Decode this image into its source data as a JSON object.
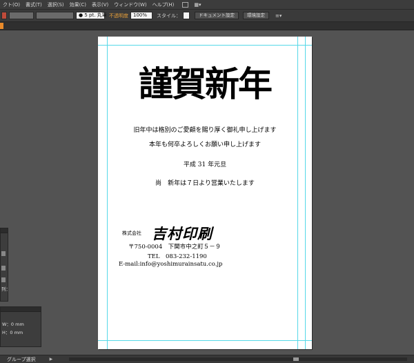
{
  "menubar": {
    "items": [
      "クト(O)",
      "書式(T)",
      "選択(S)",
      "効果(C)",
      "表示(V)",
      "ウィンドウ(W)",
      "ヘルプ(H)"
    ],
    "icon_names": [
      "document-icon",
      "workspace-icon"
    ]
  },
  "controlbar": {
    "stroke_value": "● 5 pt. 丸筆",
    "opacity_label": "不透明度",
    "opacity_value": "100%",
    "style_label": "スタイル：",
    "doc_settings_button": "ドキュメント設定",
    "env_settings_button": "環境設定"
  },
  "document": {
    "title": "謹賀新年",
    "lines": [
      "旧年中は格別のご愛顧を賜り厚く御礼申し上げます",
      "本年も何卒よろしくお願い申し上げます",
      "平成 31 年元旦",
      "尚　新年は７日より営業いたします"
    ],
    "company_prefix": "株式会社",
    "company_name": "吉村印刷",
    "address": "〒750-0004　下関市中之町５－９",
    "tel": "TEL　083-232-1190",
    "email": "E-mail:info@yoshimurainsatu.co.jp"
  },
  "transform_panel": {
    "w_label": "W：0 mm",
    "h_label": "H：0 mm"
  },
  "left_panel": {
    "label": "列："
  },
  "statusbar": {
    "tool_label": "グループ選択"
  },
  "colors": {
    "workspace_bg": "#535353",
    "guide": "#54d8e8",
    "opacity_label": "#e8a03a"
  }
}
